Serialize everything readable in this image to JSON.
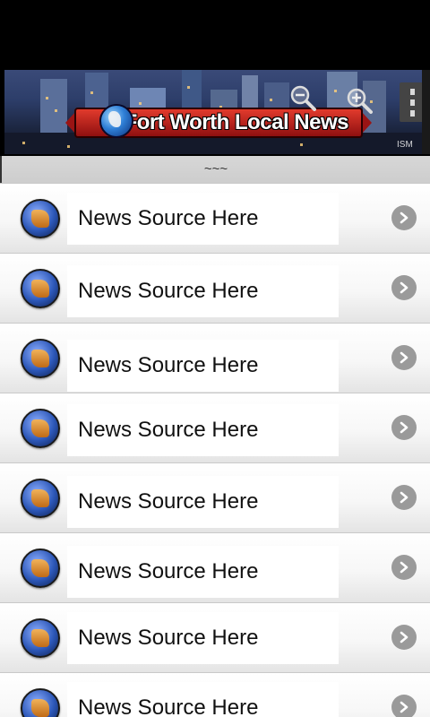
{
  "banner": {
    "title": "Fort Worth Local News",
    "stamp": "ISM"
  },
  "subheader": {
    "text": "~~~"
  },
  "list": {
    "items": [
      {
        "label": "News Source Here"
      },
      {
        "label": "News Source Here"
      },
      {
        "label": "News Source Here"
      },
      {
        "label": "News Source Here"
      },
      {
        "label": "News Source Here"
      },
      {
        "label": "News Source Here"
      },
      {
        "label": "News Source Here"
      },
      {
        "label": "News Source Here"
      }
    ]
  },
  "icons": {
    "row_icon": "news-globe-icon",
    "row_arrow": "chevron-right-icon",
    "zoom_out": "zoom-out-icon",
    "zoom_in": "zoom-in-icon",
    "menu": "overflow-menu-icon"
  },
  "colors": {
    "banner_ribbon": "#c81e1e",
    "subheader_bg": "#d4d4d4",
    "arrow_bg": "#9a9a9a"
  }
}
